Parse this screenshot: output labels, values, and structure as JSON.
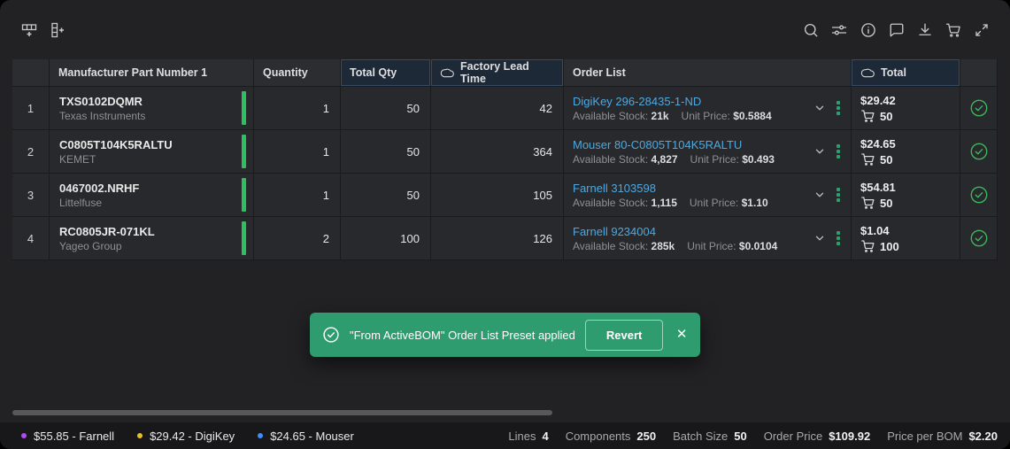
{
  "toolbar": {
    "left_icons": [
      "add-row",
      "add-column"
    ],
    "right_icons": [
      "search",
      "filter-settings",
      "info",
      "comment",
      "download",
      "cart",
      "expand"
    ]
  },
  "table": {
    "headers": {
      "row_num": "",
      "mpn": "Manufacturer Part Number 1",
      "quantity": "Quantity",
      "total_qty": "Total Qty",
      "lead_time": "Factory Lead Time",
      "order_list": "Order List",
      "total": "Total",
      "status": ""
    },
    "labels": {
      "available_stock": "Available Stock:",
      "unit_price": "Unit Price:"
    },
    "rows": [
      {
        "num": "1",
        "mpn": "TXS0102DQMR",
        "manufacturer": "Texas Instruments",
        "quantity": "1",
        "total_qty": "50",
        "lead_time": "42",
        "order_link": "DigiKey 296-28435-1-ND",
        "available_stock": "21k",
        "unit_price": "$0.5884",
        "total_price": "$29.42",
        "cart_qty": "50"
      },
      {
        "num": "2",
        "mpn": "C0805T104K5RALTU",
        "manufacturer": "KEMET",
        "quantity": "1",
        "total_qty": "50",
        "lead_time": "364",
        "order_link": "Mouser 80-C0805T104K5RALTU",
        "available_stock": "4,827",
        "unit_price": "$0.493",
        "total_price": "$24.65",
        "cart_qty": "50"
      },
      {
        "num": "3",
        "mpn": "0467002.NRHF",
        "manufacturer": "Littelfuse",
        "quantity": "1",
        "total_qty": "50",
        "lead_time": "105",
        "order_link": "Farnell 3103598",
        "available_stock": "1,115",
        "unit_price": "$1.10",
        "total_price": "$54.81",
        "cart_qty": "50"
      },
      {
        "num": "4",
        "mpn": "RC0805JR-071KL",
        "manufacturer": "Yageo Group",
        "quantity": "2",
        "total_qty": "100",
        "lead_time": "126",
        "order_link": "Farnell 9234004",
        "available_stock": "285k",
        "unit_price": "$0.0104",
        "total_price": "$1.04",
        "cart_qty": "100"
      }
    ]
  },
  "toast": {
    "message": "\"From ActiveBOM\" Order List Preset applied",
    "revert_label": "Revert",
    "close_glyph": "✕",
    "color": "#2e9c6e"
  },
  "status_bar": {
    "legend": [
      {
        "color": "#b14cf0",
        "label": "$55.85 - Farnell"
      },
      {
        "color": "#e8c021",
        "label": "$29.42 - DigiKey"
      },
      {
        "color": "#3f8cff",
        "label": "$24.65 - Mouser"
      }
    ],
    "stats": [
      {
        "label": "Lines",
        "value": "4"
      },
      {
        "label": "Components",
        "value": "250"
      },
      {
        "label": "Batch Size",
        "value": "50"
      },
      {
        "label": "Order Price",
        "value": "$109.92"
      },
      {
        "label": "Price per BOM",
        "value": "$2.20"
      }
    ]
  },
  "colors": {
    "accent_green": "#2ec05f",
    "link_blue": "#4fa8e0",
    "highlight_header": "#1d2936",
    "toast_green": "#2e9c6e"
  }
}
